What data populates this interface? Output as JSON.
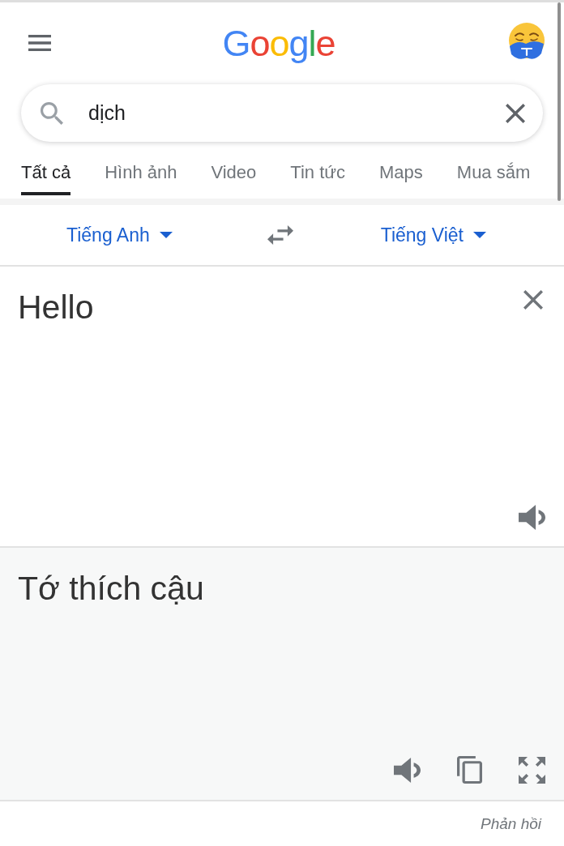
{
  "header": {
    "logo": "Google"
  },
  "search": {
    "value": "dịch"
  },
  "tabs": [
    {
      "label": "Tất cả",
      "selected": true
    },
    {
      "label": "Hình ảnh",
      "selected": false
    },
    {
      "label": "Video",
      "selected": false
    },
    {
      "label": "Tin tức",
      "selected": false
    },
    {
      "label": "Maps",
      "selected": false
    },
    {
      "label": "Mua sắm",
      "selected": false
    }
  ],
  "translator": {
    "source_language": "Tiếng Anh",
    "target_language": "Tiếng Việt",
    "source_text": "Hello",
    "translation": "Tớ thích cậu"
  },
  "feedback_link": "Phản hồi"
}
